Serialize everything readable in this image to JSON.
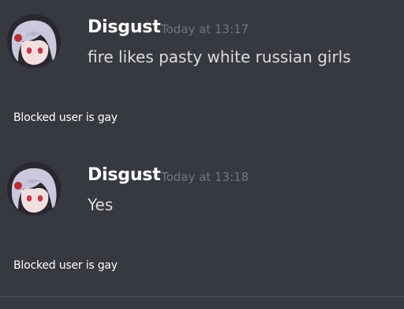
{
  "messages": [
    {
      "username": "Disgust",
      "timestamp": "Today at 13:17",
      "content": "fire likes pasty white russian girls",
      "avatar_icon": "anime-girl-avatar",
      "blocked_note": "Blocked user is gay"
    },
    {
      "username": "Disgust",
      "timestamp": "Today at 13:18",
      "content": "Yes",
      "avatar_icon": "anime-girl-avatar",
      "blocked_note": "Blocked user is gay"
    }
  ],
  "colors": {
    "background": "#36393f",
    "username": "#ffffff",
    "timestamp": "#72767d",
    "message_text": "#dcddde"
  }
}
